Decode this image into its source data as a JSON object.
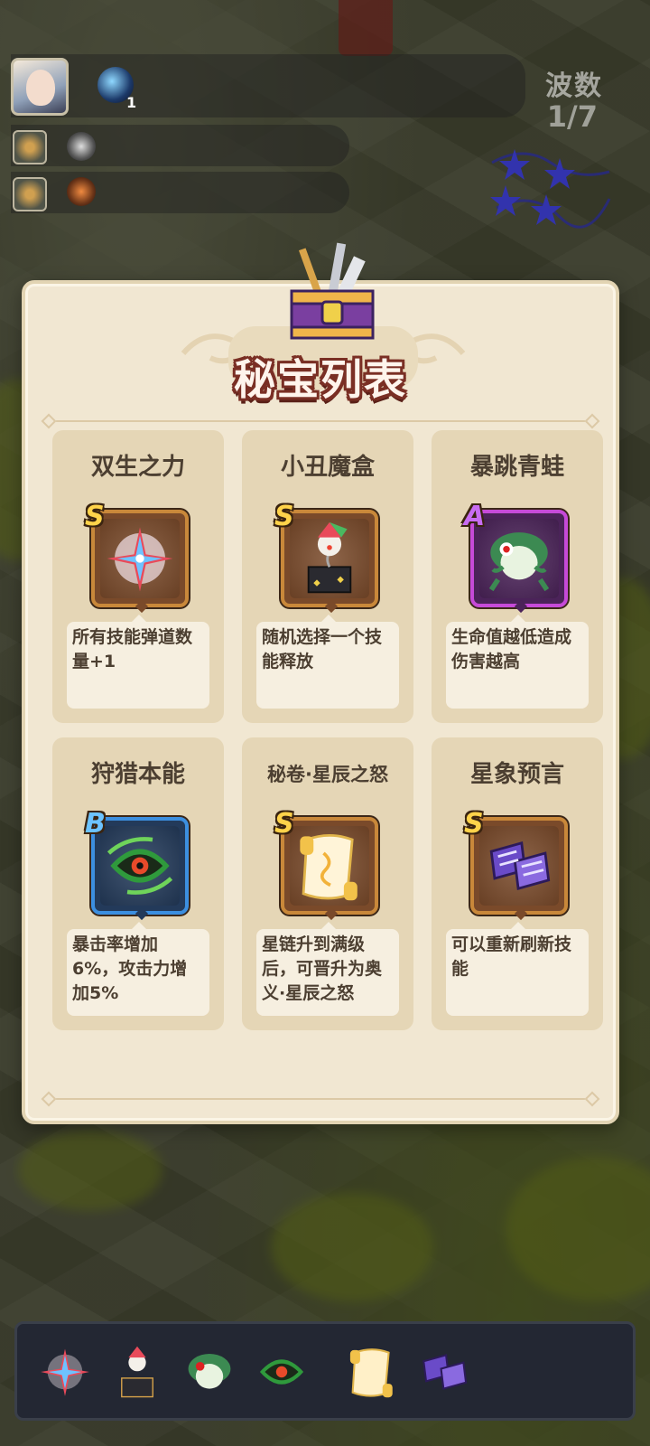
{
  "hud": {
    "hero_skill_count": "1",
    "wave_label": "波数",
    "wave_value": "1/7"
  },
  "modal": {
    "title": "秘宝列表"
  },
  "relics": [
    {
      "name": "双生之力",
      "grade": "S",
      "desc": "所有技能弹道数量+1",
      "icon": "twin-star-icon"
    },
    {
      "name": "小丑魔盒",
      "grade": "S",
      "desc": "随机选择一个技能释放",
      "icon": "jester-box-icon"
    },
    {
      "name": "暴跳青蛙",
      "grade": "A",
      "desc": "生命值越低造成伤害越高",
      "icon": "frog-icon"
    },
    {
      "name": "狩猎本能",
      "grade": "B",
      "desc": "暴击率增加6%，攻击力增加5%",
      "icon": "hunter-eye-icon"
    },
    {
      "name": "秘卷·星辰之怒",
      "grade": "S",
      "desc": "星链升到满级后，可晋升为奥义·星辰之怒",
      "icon": "golden-scroll-icon"
    },
    {
      "name": "星象预言",
      "grade": "S",
      "desc": "可以重新刷新技能",
      "icon": "star-scroll-icon"
    }
  ],
  "colors": {
    "modal_bg": "#f1e7d2",
    "card_bg": "#e5d6b6",
    "grade_s": "#ffd34a",
    "grade_a": "#c86cf2",
    "grade_b": "#6cc3ff",
    "title_outline": "#7a2f24"
  }
}
